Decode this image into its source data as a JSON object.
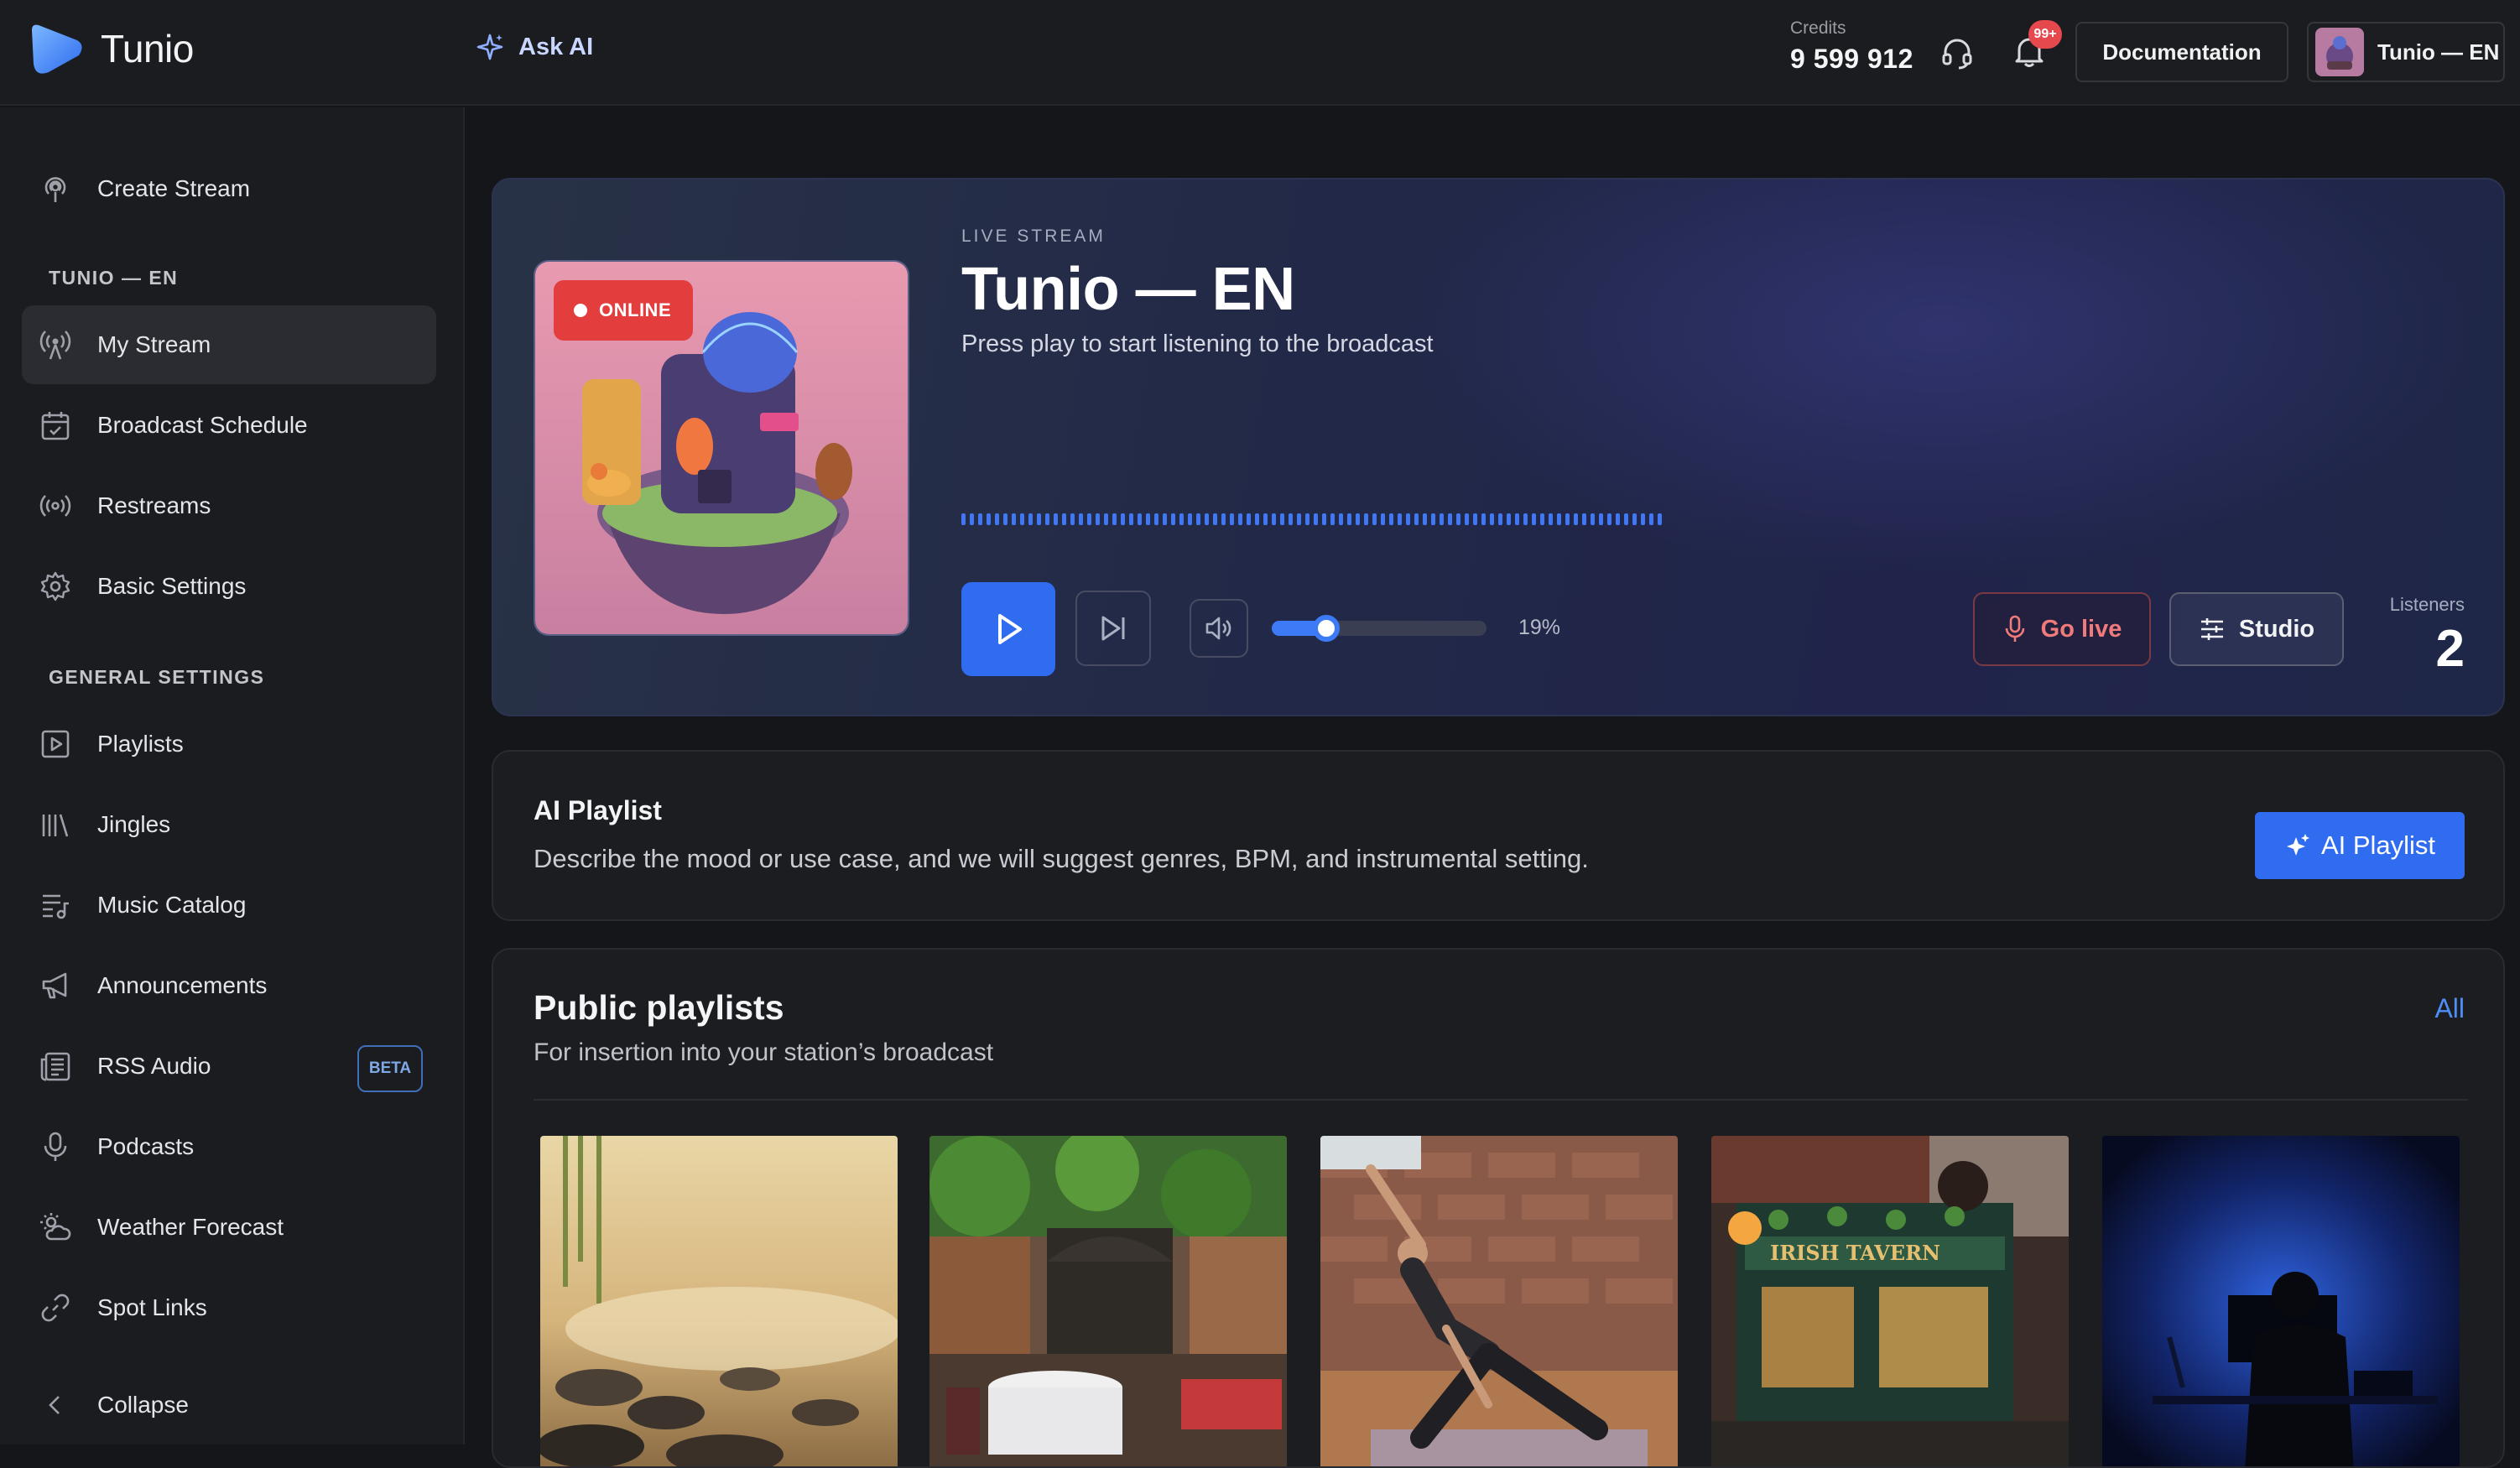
{
  "header": {
    "logo_text": "Tunio",
    "ask_ai_label": "Ask AI",
    "credits_label": "Credits",
    "credits_value": "9 599 912",
    "notifications_badge": "99+",
    "documentation_label": "Documentation",
    "account_name": "Tunio — EN",
    "icons": [
      "logo-icon",
      "sparkle-icon",
      "headset-icon",
      "bell-icon"
    ]
  },
  "sidebar": {
    "create_stream": "Create Stream",
    "section_station": "TUNIO — EN",
    "station_items": [
      {
        "label": "My Stream",
        "icon": "broadcast-icon",
        "active": true
      },
      {
        "label": "Broadcast Schedule",
        "icon": "calendar-icon"
      },
      {
        "label": "Restreams",
        "icon": "radio-waves-icon"
      },
      {
        "label": "Basic Settings",
        "icon": "gear-icon"
      }
    ],
    "section_general": "GENERAL SETTINGS",
    "general_items": [
      {
        "label": "Playlists",
        "icon": "playlist-icon"
      },
      {
        "label": "Jingles",
        "icon": "library-icon"
      },
      {
        "label": "Music Catalog",
        "icon": "music-list-icon"
      },
      {
        "label": "Announcements",
        "icon": "megaphone-icon"
      },
      {
        "label": "RSS Audio",
        "icon": "newspaper-icon",
        "badge": "BETA"
      },
      {
        "label": "Podcasts",
        "icon": "microphone-icon"
      },
      {
        "label": "Weather Forecast",
        "icon": "weather-icon"
      },
      {
        "label": "Spot Links",
        "icon": "link-icon"
      }
    ],
    "collapse_label": "Collapse"
  },
  "player": {
    "status": "ONLINE",
    "eyebrow": "LIVE STREAM",
    "title": "Tunio — EN",
    "subtitle": "Press play to start listening to the broadcast",
    "volume": 0.19,
    "volume_text": "19%",
    "go_live_label": "Go live",
    "studio_label": "Studio",
    "listeners_label": "Listeners",
    "listeners_value": "2",
    "accent": "#2f6cf0",
    "live_color": "#e33d3d"
  },
  "ai_playlist": {
    "title": "AI Playlist",
    "description": "Describe the mood or use case, and we will suggest genres, BPM, and instrumental setting.",
    "button_label": "AI Playlist"
  },
  "public_playlists": {
    "title": "Public playlists",
    "subtitle": "For insertion into your station’s broadcast",
    "all_label": "All",
    "thumbnails": [
      "spa-zen-stones",
      "italian-restaurant",
      "yoga-studio",
      "irish-tavern",
      "night-desk-blue"
    ],
    "tavern_sign_text": "IRISH TAVERN"
  }
}
